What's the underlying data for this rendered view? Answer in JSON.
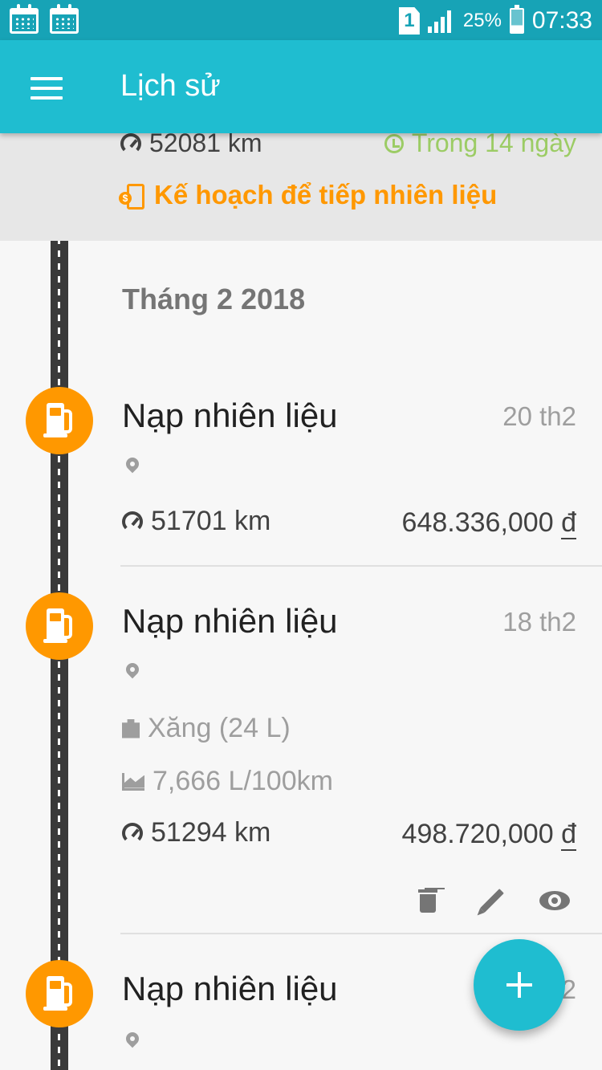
{
  "status_bar": {
    "sim_label": "1",
    "battery_text": "25%",
    "time": "07:33",
    "icons": [
      "calendar-icon",
      "calendar-icon",
      "sim-icon",
      "signal-icon",
      "battery-icon"
    ]
  },
  "app_bar": {
    "title": "Lịch sử",
    "menu_icon": "menu-icon"
  },
  "upcoming": {
    "odometer": "52081 km",
    "due": "Trong 14 ngày",
    "plan_label": "Kế hoạch để tiếp nhiên liệu"
  },
  "month": {
    "title": "Tháng 2 2018"
  },
  "entries": [
    {
      "title": "Nạp nhiên liệu",
      "date": "20 th2",
      "odometer": "51701 km",
      "amount": "648.336,000",
      "currency": "đ"
    },
    {
      "title": "Nạp nhiên liệu",
      "date": "18 th2",
      "fuel": "Xăng (24 L)",
      "consumption": "7,666 L/100km",
      "odometer": "51294 km",
      "amount": "498.720,000",
      "currency": "đ"
    },
    {
      "title": "Nạp nhiên liệu",
      "date": "2"
    }
  ],
  "colors": {
    "status_bar": "#17a3b6",
    "app_bar": "#1fbdd0",
    "accent_orange": "#ff9800",
    "due_green": "#9ccc65"
  }
}
